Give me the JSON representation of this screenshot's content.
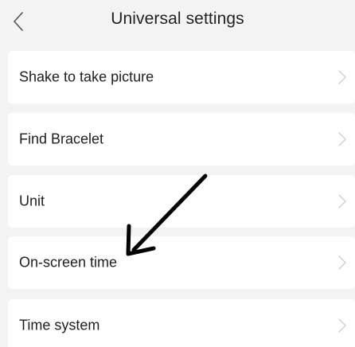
{
  "header": {
    "title": "Universal settings",
    "back_icon": "chevron-left-icon"
  },
  "settings": {
    "items": [
      {
        "label": "Shake to take picture",
        "icon": "chevron-right-icon"
      },
      {
        "label": "Find Bracelet",
        "icon": "chevron-right-icon"
      },
      {
        "label": "Unit",
        "icon": "chevron-right-icon"
      },
      {
        "label": "On-screen time",
        "icon": "chevron-right-icon"
      },
      {
        "label": "Time system",
        "icon": "chevron-right-icon"
      }
    ]
  },
  "annotation": {
    "icon": "arrow-icon",
    "color": "#000000"
  },
  "colors": {
    "background": "#f3f3f3",
    "card": "#ffffff",
    "text": "#1e1e1e",
    "chevron": "#cfcfcf"
  }
}
